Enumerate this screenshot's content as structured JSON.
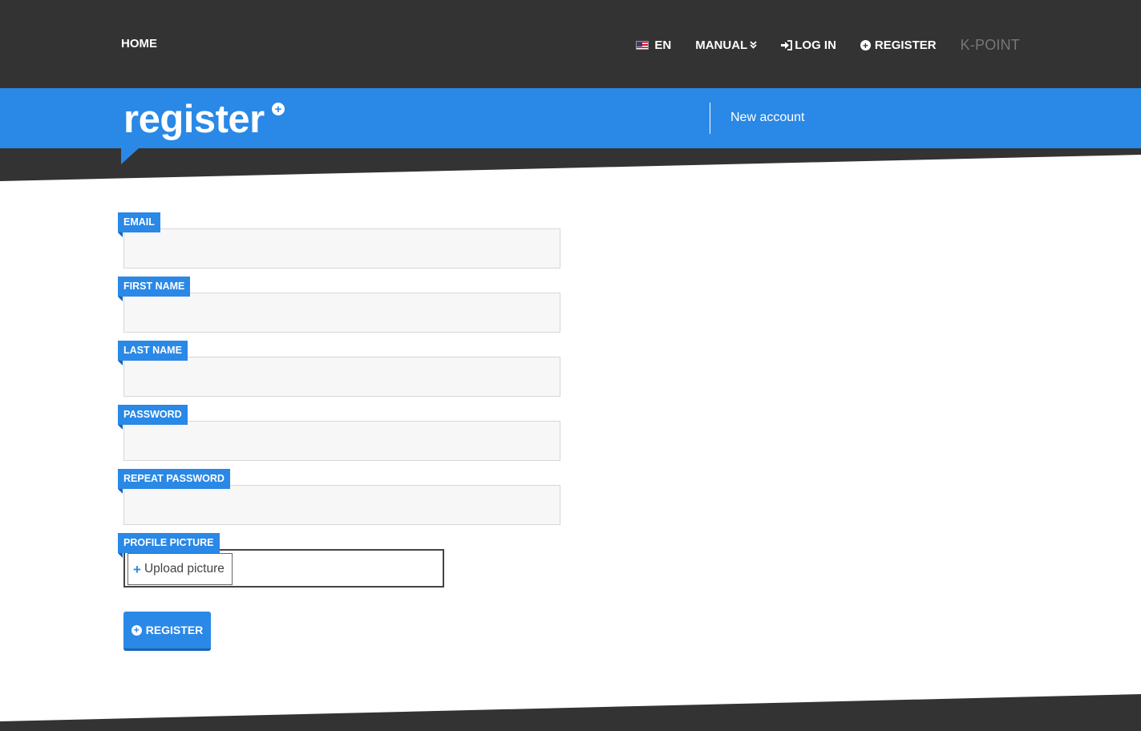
{
  "nav": {
    "home": "HOME",
    "language": "EN",
    "manual": "MANUAL",
    "login": "LOG IN",
    "register": "REGISTER",
    "brand": "K-POINT"
  },
  "header": {
    "title": "register",
    "subtitle": "New account"
  },
  "form": {
    "email_label": "EMAIL",
    "email_value": "",
    "first_name_label": "FIRST NAME",
    "first_name_value": "",
    "last_name_label": "LAST NAME",
    "last_name_value": "",
    "password_label": "PASSWORD",
    "password_value": "",
    "repeat_password_label": "REPEAT PASSWORD",
    "repeat_password_value": "",
    "profile_picture_label": "PROFILE PICTURE",
    "upload_label": "Upload picture",
    "submit_label": "REGISTER"
  },
  "colors": {
    "accent": "#2a88e6",
    "dark": "#333333",
    "brand_text": "#777777"
  },
  "icons": {
    "language": "us-flag-icon",
    "manual": "double-chevron-down-icon",
    "login": "sign-in-icon",
    "register": "plus-circle-icon",
    "upload": "plus-icon"
  }
}
